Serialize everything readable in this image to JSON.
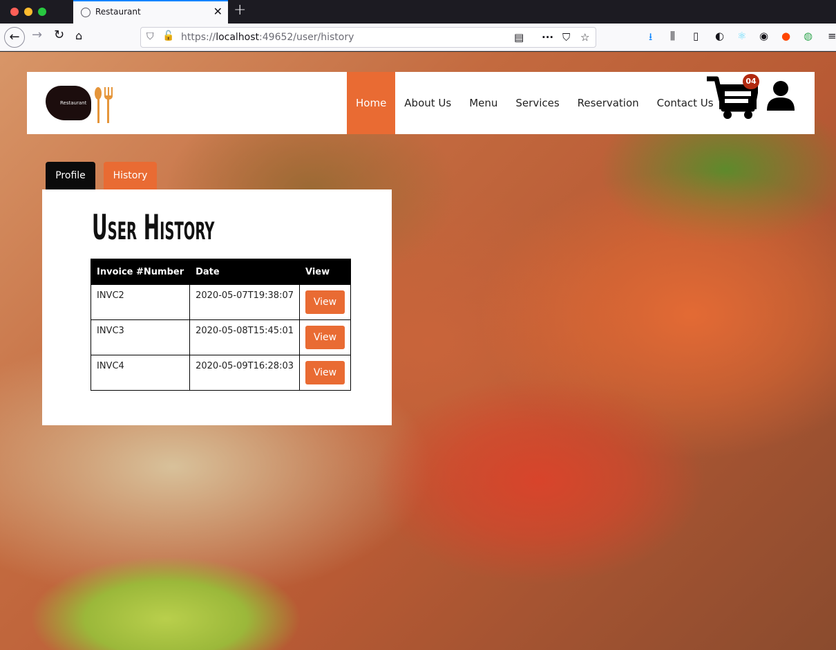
{
  "browser": {
    "tab_title": "Restaurant",
    "url_prefix": "https://",
    "url_host": "localhost",
    "url_rest": ":49652/user/history"
  },
  "site": {
    "logo_text": "Restaurant",
    "menu": [
      {
        "label": "Home",
        "active": true
      },
      {
        "label": "About Us"
      },
      {
        "label": "Menu"
      },
      {
        "label": "Services"
      },
      {
        "label": "Reservation"
      },
      {
        "label": "Contact Us"
      }
    ],
    "cart_count": "04",
    "accent_color": "#e96b33"
  },
  "profile_tabs": {
    "profile": "Profile",
    "history": "History"
  },
  "history": {
    "title": "User History",
    "columns": [
      "Invoice #Number",
      "Date",
      "View"
    ],
    "rows": [
      {
        "invoice": "INVC2",
        "date": "2020-05-07T19:38:07",
        "action": "View"
      },
      {
        "invoice": "INVC3",
        "date": "2020-05-08T15:45:01",
        "action": "View"
      },
      {
        "invoice": "INVC4",
        "date": "2020-05-09T16:28:03",
        "action": "View"
      }
    ]
  }
}
